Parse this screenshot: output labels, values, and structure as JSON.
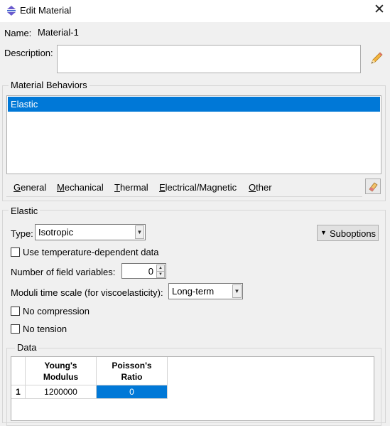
{
  "window": {
    "title": "Edit Material",
    "close_glyph": "✕",
    "app_icon": "abaqus-icon"
  },
  "name": {
    "label": "Name:",
    "value": "Material-1"
  },
  "description": {
    "label": "Description:",
    "value": "",
    "edit_icon": "pencil-icon"
  },
  "behaviors": {
    "group_title": "Material Behaviors",
    "items": [
      "Elastic"
    ],
    "selected_index": 0,
    "menu": [
      {
        "label": "General",
        "mnemonic": "G",
        "rest": "eneral"
      },
      {
        "label": "Mechanical",
        "mnemonic": "M",
        "rest": "echanical"
      },
      {
        "label": "Thermal",
        "mnemonic": "T",
        "rest": "hermal"
      },
      {
        "label": "Electrical/Magnetic",
        "mnemonic": "E",
        "rest": "lectrical/Magnetic"
      },
      {
        "label": "Other",
        "mnemonic": "O",
        "rest": "ther"
      }
    ],
    "delete_icon": "eraser-icon"
  },
  "elastic": {
    "group_title": "Elastic",
    "type_label": "Type:",
    "type_value": "Isotropic",
    "suboptions_label": "Suboptions",
    "temp_dependent_label": "Use temperature-dependent data",
    "temp_dependent_checked": false,
    "field_vars_label": "Number of field variables:",
    "field_vars_value": "0",
    "moduli_label": "Moduli time scale (for viscoelasticity):",
    "moduli_value": "Long-term",
    "no_compression_label": "No compression",
    "no_compression_checked": false,
    "no_tension_label": "No tension",
    "no_tension_checked": false
  },
  "data": {
    "group_title": "Data",
    "columns": [
      {
        "line1": "Young's",
        "line2": "Modulus"
      },
      {
        "line1": "Poisson's",
        "line2": "Ratio"
      }
    ],
    "rows": [
      {
        "index": "1",
        "cells": [
          "1200000",
          "0"
        ],
        "selected_col": 1
      }
    ]
  },
  "colors": {
    "selection": "#0078d7",
    "background": "#f0f0f0"
  }
}
